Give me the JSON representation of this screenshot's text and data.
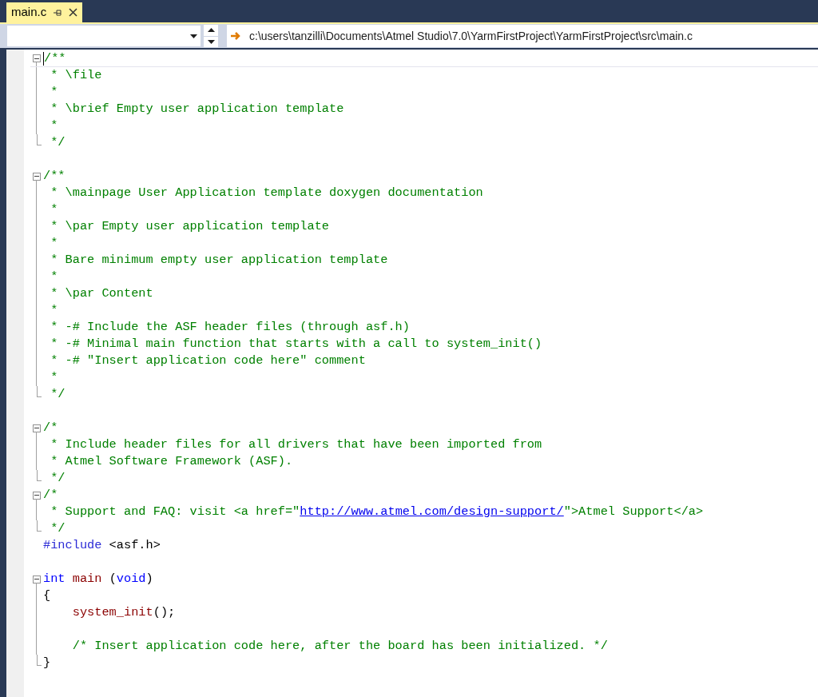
{
  "tabs": [
    {
      "label": "main.c",
      "selected": true,
      "pinned": false
    }
  ],
  "navigation": {
    "path": "c:\\users\\tanzilli\\Documents\\Atmel Studio\\7.0\\YarmFirstProject\\YarmFirstProject\\src\\main.c"
  },
  "editor": {
    "lines": [
      {
        "kind": "start",
        "expanded": true,
        "current": true,
        "tokens": [
          {
            "kind": "comment",
            "text": "/**"
          }
        ]
      },
      {
        "kind": "body",
        "current": false,
        "tokens": [
          {
            "kind": "comment",
            "text": " * \\file"
          }
        ]
      },
      {
        "kind": "body",
        "current": false,
        "tokens": [
          {
            "kind": "comment",
            "text": " *"
          }
        ]
      },
      {
        "kind": "body",
        "current": false,
        "tokens": [
          {
            "kind": "comment",
            "text": " * \\brief Empty user application template"
          }
        ]
      },
      {
        "kind": "body",
        "current": false,
        "tokens": [
          {
            "kind": "comment",
            "text": " *"
          }
        ]
      },
      {
        "kind": "end",
        "current": false,
        "tokens": [
          {
            "kind": "comment",
            "text": " */"
          }
        ]
      },
      {
        "kind": "none",
        "current": false
      },
      {
        "kind": "start",
        "expanded": true,
        "current": false,
        "tokens": [
          {
            "kind": "comment",
            "text": "/**"
          }
        ]
      },
      {
        "kind": "body",
        "current": false,
        "tokens": [
          {
            "kind": "comment",
            "text": " * \\mainpage User Application template doxygen documentation"
          }
        ]
      },
      {
        "kind": "body",
        "current": false,
        "tokens": [
          {
            "kind": "comment",
            "text": " *"
          }
        ]
      },
      {
        "kind": "body",
        "current": false,
        "tokens": [
          {
            "kind": "comment",
            "text": " * \\par Empty user application template"
          }
        ]
      },
      {
        "kind": "body",
        "current": false,
        "tokens": [
          {
            "kind": "comment",
            "text": " *"
          }
        ]
      },
      {
        "kind": "body",
        "current": false,
        "tokens": [
          {
            "kind": "comment",
            "text": " * Bare minimum empty user application template"
          }
        ]
      },
      {
        "kind": "body",
        "current": false,
        "tokens": [
          {
            "kind": "comment",
            "text": " *"
          }
        ]
      },
      {
        "kind": "body",
        "current": false,
        "tokens": [
          {
            "kind": "comment",
            "text": " * \\par Content"
          }
        ]
      },
      {
        "kind": "body",
        "current": false,
        "tokens": [
          {
            "kind": "comment",
            "text": " *"
          }
        ]
      },
      {
        "kind": "body",
        "current": false,
        "tokens": [
          {
            "kind": "comment",
            "text": " * -# Include the ASF header files (through asf.h)"
          }
        ]
      },
      {
        "kind": "body",
        "current": false,
        "tokens": [
          {
            "kind": "comment",
            "text": " * -# Minimal main function that starts with a call to system_init()"
          }
        ]
      },
      {
        "kind": "body",
        "current": false,
        "tokens": [
          {
            "kind": "comment",
            "text": " * -# \"Insert application code here\" comment"
          }
        ]
      },
      {
        "kind": "body",
        "current": false,
        "tokens": [
          {
            "kind": "comment",
            "text": " *"
          }
        ]
      },
      {
        "kind": "end",
        "current": false,
        "tokens": [
          {
            "kind": "comment",
            "text": " */"
          }
        ]
      },
      {
        "kind": "none",
        "current": false
      },
      {
        "kind": "start",
        "expanded": true,
        "current": false,
        "tokens": [
          {
            "kind": "comment",
            "text": "/*"
          }
        ]
      },
      {
        "kind": "body",
        "current": false,
        "tokens": [
          {
            "kind": "comment",
            "text": " * Include header files for all drivers that have been imported from"
          }
        ]
      },
      {
        "kind": "body",
        "current": false,
        "tokens": [
          {
            "kind": "comment",
            "text": " * Atmel Software Framework (ASF)."
          }
        ]
      },
      {
        "kind": "end",
        "current": false,
        "tokens": [
          {
            "kind": "comment",
            "text": " */"
          }
        ]
      },
      {
        "kind": "start",
        "expanded": true,
        "current": false,
        "tokens": [
          {
            "kind": "comment",
            "text": "/*"
          }
        ]
      },
      {
        "kind": "body",
        "current": false,
        "tokens": [
          {
            "kind": "comment",
            "text": " * Support and FAQ: visit <a href=\""
          },
          {
            "kind": "link",
            "text": "http://www.atmel.com/design-support/"
          },
          {
            "kind": "comment",
            "text": "\">Atmel Support</a>"
          }
        ]
      },
      {
        "kind": "end",
        "current": false,
        "tokens": [
          {
            "kind": "comment",
            "text": " */"
          }
        ]
      },
      {
        "kind": "none",
        "current": false,
        "tokens": [
          {
            "kind": "preproc",
            "text": "#include"
          },
          {
            "kind": "plain",
            "text": " <asf.h>"
          }
        ]
      },
      {
        "kind": "none",
        "current": false
      },
      {
        "kind": "start",
        "expanded": true,
        "current": false,
        "tokens": [
          {
            "kind": "keyword",
            "text": "int"
          },
          {
            "kind": "function",
            "text": " main"
          },
          {
            "kind": "plain",
            "text": " ("
          },
          {
            "kind": "keyword",
            "text": "void"
          },
          {
            "kind": "plain",
            "text": ")"
          }
        ]
      },
      {
        "kind": "body",
        "current": false,
        "tokens": [
          {
            "kind": "plain",
            "text": "{"
          }
        ]
      },
      {
        "kind": "body",
        "current": false,
        "tokens": [
          {
            "kind": "function",
            "text": "    system_init"
          },
          {
            "kind": "plain",
            "text": "();"
          }
        ]
      },
      {
        "kind": "body",
        "current": false
      },
      {
        "kind": "body",
        "current": false,
        "tokens": [
          {
            "kind": "comment",
            "text": "    /* Insert application code here, after the board has been initialized. */"
          }
        ]
      },
      {
        "kind": "end",
        "current": false,
        "tokens": [
          {
            "kind": "plain",
            "text": "}"
          }
        ]
      }
    ]
  }
}
